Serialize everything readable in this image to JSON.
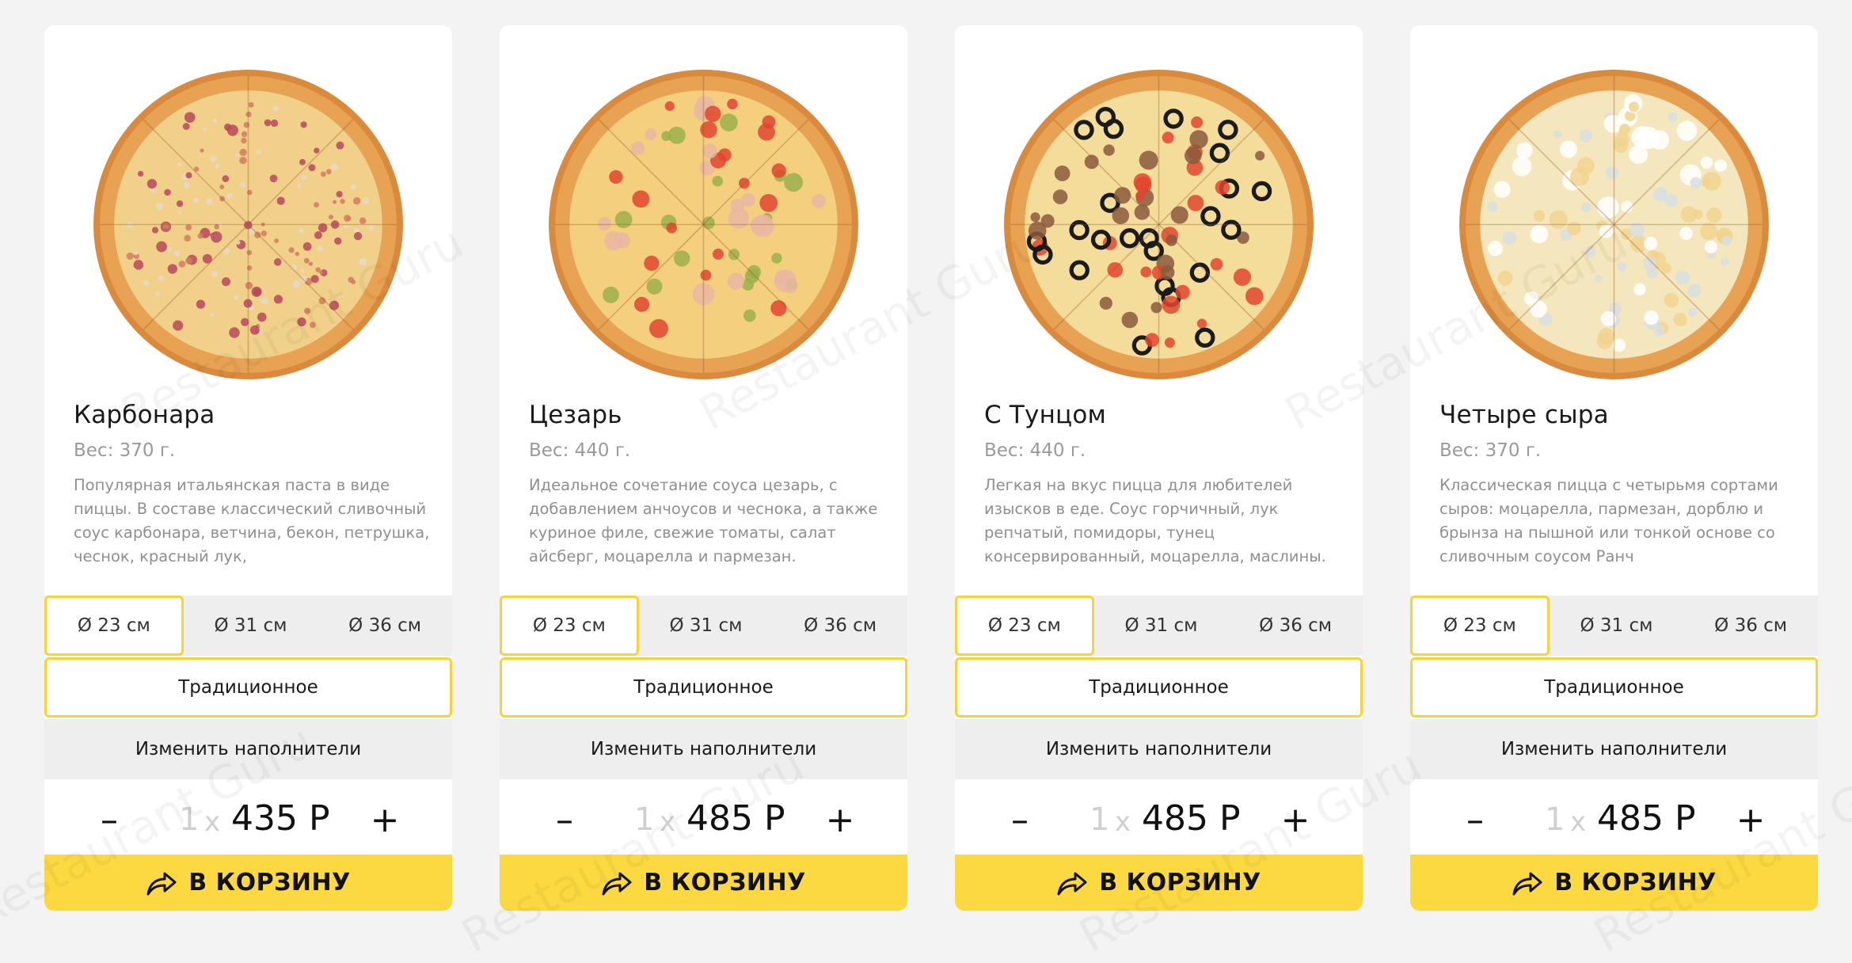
{
  "products": [
    {
      "name": "Карбонара",
      "weight": "Вес: 370 г.",
      "description": "Популярная итальянская паста в виде пиццы. В составе классический сливочный соус карбонара, ветчина, бекон, петрушка, чеснок, красный лук,",
      "sizes": [
        "Ø 23 см",
        "Ø 31 см",
        "Ø 36 см"
      ],
      "selected_size": 0,
      "dough": "Традиционное",
      "toppings_label": "Изменить наполнители",
      "quantity": "1",
      "times": "x",
      "price": "435 Р",
      "cart_label": "В КОРЗИНУ",
      "image_icon": "pizza-carbonara-photo"
    },
    {
      "name": "Цезарь",
      "weight": "Вес: 440 г.",
      "description": "Идеальное сочетание соуса цезарь, с добавлением анчоусов и чеснока, а также куриное филе, свежие томаты, салат айсберг, моцарелла и пармезан.",
      "sizes": [
        "Ø 23 см",
        "Ø 31 см",
        "Ø 36 см"
      ],
      "selected_size": 0,
      "dough": "Традиционное",
      "toppings_label": "Изменить наполнители",
      "quantity": "1",
      "times": "x",
      "price": "485 Р",
      "cart_label": "В КОРЗИНУ",
      "image_icon": "pizza-caesar-photo"
    },
    {
      "name": "С Тунцом",
      "weight": "Вес: 440 г.",
      "description": "Легкая на вкус пицца для любителей изысков в еде. Соус горчичный, лук репчатый, помидоры, тунец консервированный, моцарелла, маслины.",
      "sizes": [
        "Ø 23 см",
        "Ø 31 см",
        "Ø 36 см"
      ],
      "selected_size": 0,
      "dough": "Традиционное",
      "toppings_label": "Изменить наполнители",
      "quantity": "1",
      "times": "x",
      "price": "485 Р",
      "cart_label": "В КОРЗИНУ",
      "image_icon": "pizza-tuna-photo"
    },
    {
      "name": "Четыре сыра",
      "weight": "Вес: 370 г.",
      "description": "Классическая пицца с четырьмя сортами сыров: моцарелла, пармезан, дорблю и брынза на пышной или тонкой основе со сливочным соусом Ранч",
      "sizes": [
        "Ø 23 см",
        "Ø 31 см",
        "Ø 36 см"
      ],
      "selected_size": 0,
      "dough": "Традиционное",
      "toppings_label": "Изменить наполнители",
      "quantity": "1",
      "times": "x",
      "price": "485 Р",
      "cart_label": "В КОРЗИНУ",
      "image_icon": "pizza-four-cheese-photo"
    }
  ],
  "watermark_text": "Restaurant Guru",
  "colors": {
    "accent": "#fcd940",
    "accent_border": "#f7d23b",
    "page_bg": "#f3f3f3",
    "muted_bar": "#eeeeee"
  }
}
